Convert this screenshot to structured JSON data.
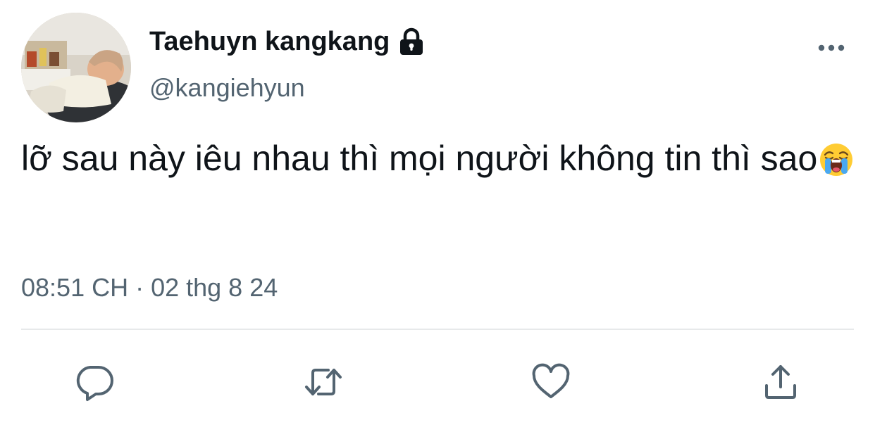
{
  "author": {
    "display_name": "Taehuyn kangkang",
    "handle": "@kangiehyun",
    "protected_icon": "lock-icon",
    "avatar": "profile-photo"
  },
  "tweet": {
    "text": "lỡ sau này iêu nhau thì mọi người không tin thì sao",
    "emoji": "loudly-crying-face",
    "timestamp": "08:51 CH · 02 thg 8 24"
  },
  "actions": {
    "reply_icon": "reply-icon",
    "retweet_icon": "retweet-icon",
    "like_icon": "heart-icon",
    "share_icon": "share-icon",
    "more_icon": "more-icon"
  },
  "colors": {
    "text_primary": "#0f1419",
    "text_secondary": "#536471",
    "divider": "#e7e9ea",
    "icon": "#536471"
  }
}
